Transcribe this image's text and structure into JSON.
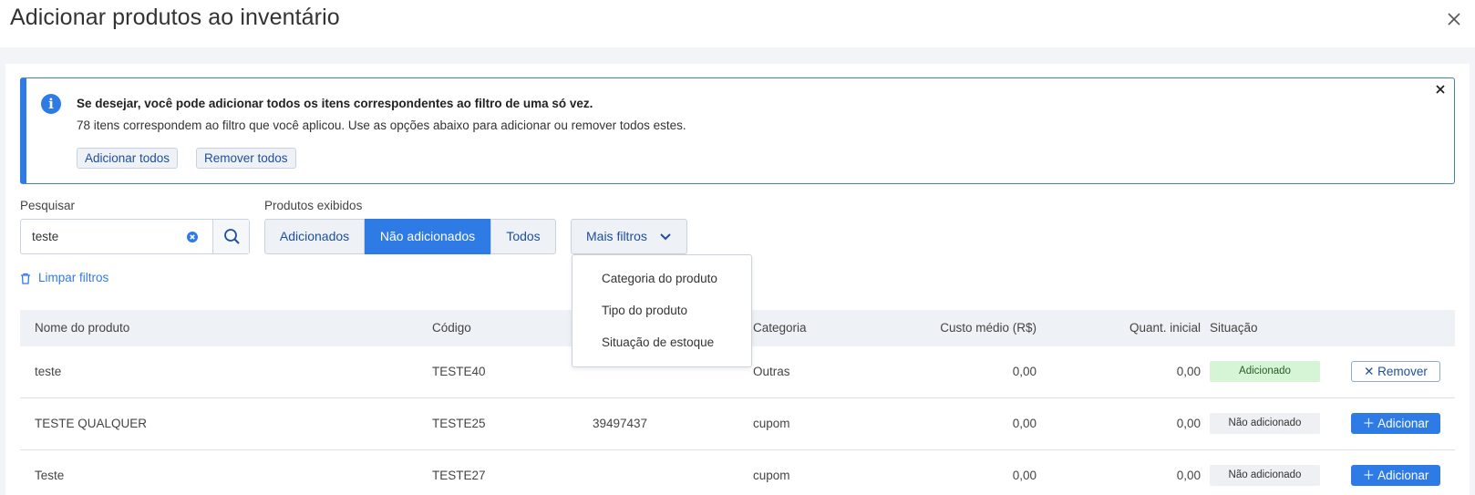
{
  "header": {
    "title": "Adicionar produtos ao inventário"
  },
  "banner": {
    "title": "Se desejar, você pode adicionar todos os itens correspondentes ao filtro de uma só vez.",
    "text": "78 itens correspondem ao filtro que você aplicou. Use as opções abaixo para adicionar ou remover todos estes.",
    "add_all_label": "Adicionar todos",
    "remove_all_label": "Remover todos"
  },
  "search": {
    "label": "Pesquisar",
    "value": "teste"
  },
  "displayed": {
    "label": "Produtos exibidos",
    "options": [
      "Adicionados",
      "Não adicionados",
      "Todos"
    ],
    "selected": "Não adicionados"
  },
  "more_filters": {
    "label": "Mais filtros",
    "items": [
      "Categoria do produto",
      "Tipo do produto",
      "Situação de estoque"
    ]
  },
  "clear_filters_label": "Limpar filtros",
  "table": {
    "columns": [
      "Nome do produto",
      "Código",
      "",
      "Categoria",
      "Custo médio (R$)",
      "Quant. inicial",
      "Situação"
    ],
    "rows": [
      {
        "name": "teste",
        "code": "TESTE40",
        "gtin": "",
        "category": "Outras",
        "cost": "0,00",
        "qty": "0,00",
        "status": "Adicionado",
        "action": "Remover"
      },
      {
        "name": "TESTE QUALQUER",
        "code": "TESTE25",
        "gtin": "39497437",
        "category": "cupom",
        "cost": "0,00",
        "qty": "0,00",
        "status": "Não adicionado",
        "action": "Adicionar"
      },
      {
        "name": "Teste",
        "code": "TESTE27",
        "gtin": "",
        "category": "cupom",
        "cost": "0,00",
        "qty": "0,00",
        "status": "Não adicionado",
        "action": "Adicionar"
      }
    ]
  },
  "colors": {
    "primary": "#2f7be5",
    "added_badge": "#d6f5d6",
    "link": "#1d4f9c"
  }
}
